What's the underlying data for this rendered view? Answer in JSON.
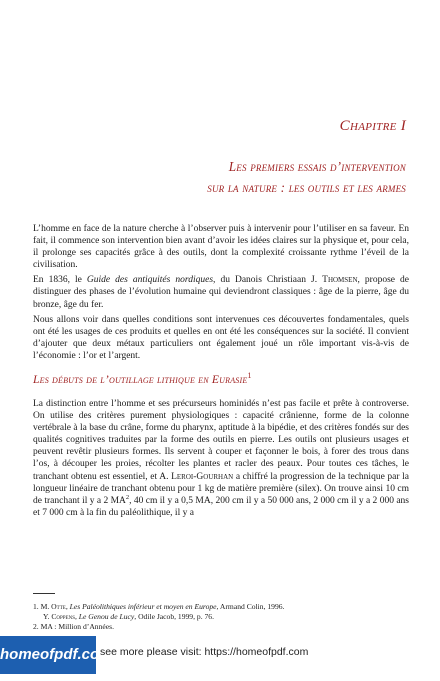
{
  "chapter": "Chapitre I",
  "title_line1": "Les premiers essais d’intervention",
  "title_line2": "sur la nature : les outils et les armes",
  "intro": {
    "p1": "L’homme en face de la nature cherche à l’observer puis à intervenir pour l’utiliser en sa faveur. En fait, il commence son intervention bien avant d’avoir les idées claires sur la physique et, pour cela, il prolonge ses capacités grâce à des outils, dont la complexité croissante rythme l’éveil de la civilisation.",
    "p2_a": "En 1836, le ",
    "p2_book": "Guide des antiquités nordiques",
    "p2_b": ", du Danois Christiaan J. ",
    "p2_name": "Thomsen",
    "p2_c": ", propose de distinguer des phases de l’évolution humaine qui deviendront classiques : âge de la pierre, âge du bronze, âge du fer.",
    "p3": "Nous allons voir dans quelles conditions sont intervenues ces découvertes fondamentales, quels ont été les usages de ces produits et quelles en ont été les conséquences sur la société. Il convient d’ajouter que deux métaux particuliers ont également joué un rôle important vis-à-vis de l’économie : l’or et l’argent."
  },
  "section": {
    "title": "Les débuts de l’outillage lithique en Eurasie",
    "note_ref": "1",
    "text_a": "La distinction entre l’homme et ses précurseurs hominidés n’est pas facile et prête à controverse. On utilise des critères purement physiologiques : capacité crânienne, forme de la colonne vertébrale à la base du crâne, forme du pharynx, aptitude à la bipédie, et des critères fondés sur des qualités cognitives traduites par la forme des outils en pierre. Les outils ont plusieurs usages et peuvent revêtir plusieurs formes. Ils servent à couper et façonner le bois, à forer des trous dans l’os, à découper les proies, récolter les plantes et racler des peaux. Pour toutes ces tâches, le tranchant obtenu est essentiel, et A. ",
    "name": "Leroi-Gourhan",
    "text_b": " a chiffré la progression de la technique par la longueur linéaire de tranchant obtenu pour 1 kg de matière première (silex). On trouve ainsi 10 cm de tranchant il y a 2 MA",
    "note2": "2",
    "text_c": ", 40 cm il y a 0,5 MA, 200 cm il y a 50 000 ans, 2 000 cm il y a 2 000 ans et 7 000 cm à la fin du paléolithique, il y a"
  },
  "footnotes": {
    "n1_num": "1.",
    "n1_a": "M. ",
    "n1_author": "Otte",
    "n1_b": ", ",
    "n1_book": "Les Paléolithiques inférieur et moyen en Europe",
    "n1_c": ", Armand Colin, 1996.",
    "n1b_a": "Y. ",
    "n1b_author": "Coppens",
    "n1b_b": ", ",
    "n1b_book": "Le Genou de Lucy",
    "n1b_c": ", Odile Jacob, 1999, p. 76.",
    "n2_partial": "2. MA : Million d’Années."
  },
  "banner": {
    "logo": "homeofpdf.com",
    "text": "see more please visit: https://homeofpdf.com"
  }
}
